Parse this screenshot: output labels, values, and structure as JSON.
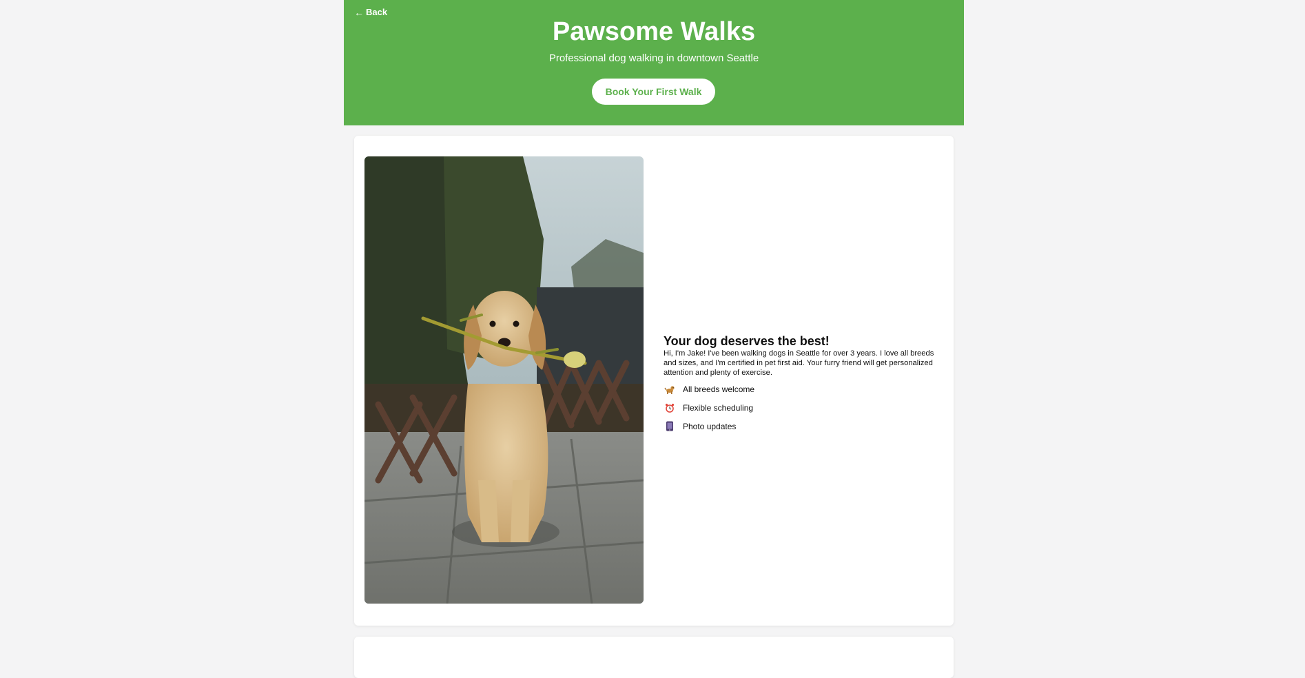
{
  "header": {
    "back_label": "Back",
    "title": "Pawsome Walks",
    "subtitle": "Professional dog walking in downtown Seattle",
    "cta_label": "Book Your First Walk"
  },
  "about": {
    "title": "Your dog deserves the best!",
    "body": "Hi, I'm Jake! I've been walking dogs in Seattle for over 3 years. I love all breeds and sizes, and I'm certified in pet first aid. Your furry friend will get personalized attention and plenty of exercise.",
    "features": [
      {
        "icon": "dog-icon",
        "label": "All breeds welcome"
      },
      {
        "icon": "alarm-clock-icon",
        "label": "Flexible scheduling"
      },
      {
        "icon": "phone-icon",
        "label": "Photo updates"
      }
    ]
  },
  "colors": {
    "brand_green": "#5cb04c",
    "page_background": "#f4f4f5"
  }
}
